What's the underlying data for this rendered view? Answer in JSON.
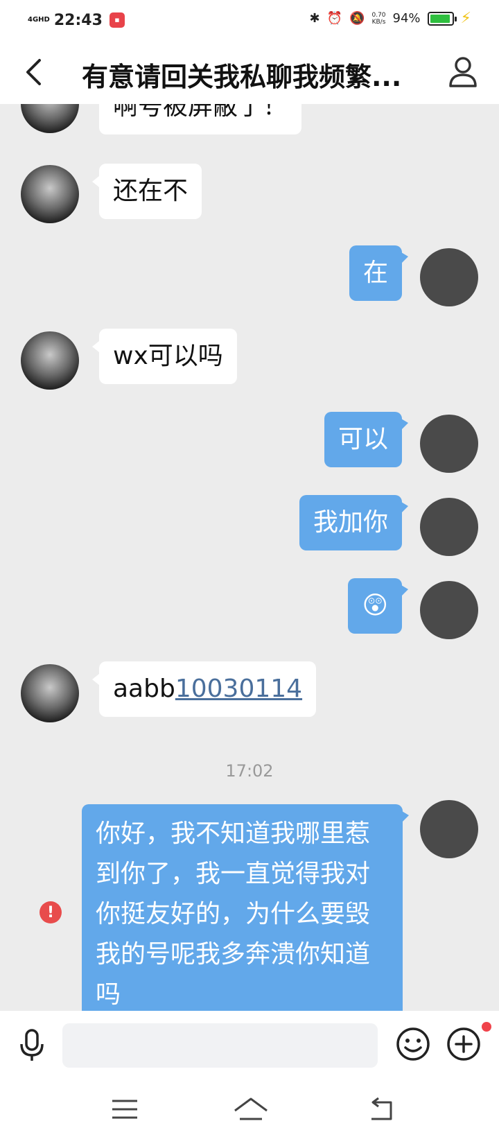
{
  "status_bar": {
    "network": "4GHD",
    "time": "22:43",
    "speed_value": "0.70",
    "speed_unit": "KB/s",
    "battery": "94%",
    "battery_level": 0.94,
    "icons": [
      "bluetooth-icon",
      "alarm-icon",
      "mute-icon",
      "battery-icon",
      "charging-icon"
    ]
  },
  "header": {
    "title": "有意请回关我私聊我频繁..."
  },
  "messages": [
    {
      "side": "in",
      "text": "啊号被屏蔽了！"
    },
    {
      "side": "in",
      "text": "还在不"
    },
    {
      "side": "out",
      "text": "在"
    },
    {
      "side": "in",
      "text": "wx可以吗"
    },
    {
      "side": "out",
      "text": "可以"
    },
    {
      "side": "out",
      "text": "我加你"
    },
    {
      "side": "out",
      "text": "😲",
      "emoji": "astonished-face-emoji"
    },
    {
      "side": "in",
      "text_prefix": "aabb",
      "text_link": "10030114"
    },
    {
      "side": "out",
      "text": "你好，我不知道我哪里惹到你了，我一直觉得我对你挺友好的，为什么要毁我的号呢我多奔溃你知道吗",
      "status": "failed"
    }
  ],
  "timestamp": "17:02",
  "input": {
    "placeholder": ""
  },
  "colors": {
    "outgoing_bubble": "#62a8ea",
    "incoming_bubble": "#ffffff",
    "chat_background": "#ececec",
    "error": "#e84c4c",
    "notification_dot": "#f0434b"
  }
}
